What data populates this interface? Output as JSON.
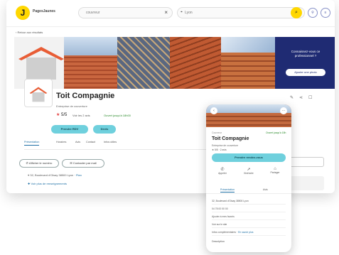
{
  "header": {
    "logo_glyph": "J",
    "brand": "PagesJaunes",
    "what_value": "couvreur",
    "where_value": "Lyon",
    "clear_glyph": "×",
    "search_glyph": "⌕",
    "btn_a": "⚲",
    "btn_b": "≡"
  },
  "nav": {
    "back_label": "‹ Retour aux résultats"
  },
  "promo": {
    "question": "Connaissez-vous ce professionnel ?",
    "button": "Ajouter une photo"
  },
  "business": {
    "name": "Toit Compagnie",
    "category": "Entreprise de couverture",
    "rating": "5",
    "rating_max": "/5",
    "reviews": "Voir les 2 avis",
    "tag": "Ouvert jusqu'à 18h00",
    "buttons": [
      "Prendre RDV",
      "Devis"
    ],
    "tabs": [
      "Présentation",
      "Horaires",
      "Avis",
      "Contact",
      "Infos utiles"
    ],
    "call_btn": "Afficher le numéro",
    "mail_btn": "Contacter par mail",
    "address": "32, Boulevard d'Oisay 38500 Lyon",
    "address_link": "Plan",
    "services": "Voir plus de renseignements"
  },
  "phone": {
    "tag_left": "Couvreur",
    "tag_right": "Ouvert jusqu'à 18h",
    "name": "Toit Compagnie",
    "category": "Entreprise de couverture",
    "rating_line": "★ 5/5 · 2 avis",
    "cta": "Prendre rendez-vous",
    "actions": [
      {
        "icon": "✆",
        "label": "Appeler"
      },
      {
        "icon": "➚",
        "label": "Itinéraire"
      },
      {
        "icon": "⌂",
        "label": "Partager"
      }
    ],
    "tabs": [
      "Présentation",
      "Avis"
    ],
    "rows": [
      "32, Boulevard d'Oisay 38500 Lyon",
      "04 78 00 00 00",
      "Ajouter à mes favoris",
      "Voir sur le site",
      "Infos complémentaires"
    ],
    "row_link": "En savoir plus",
    "desc": "Description"
  }
}
